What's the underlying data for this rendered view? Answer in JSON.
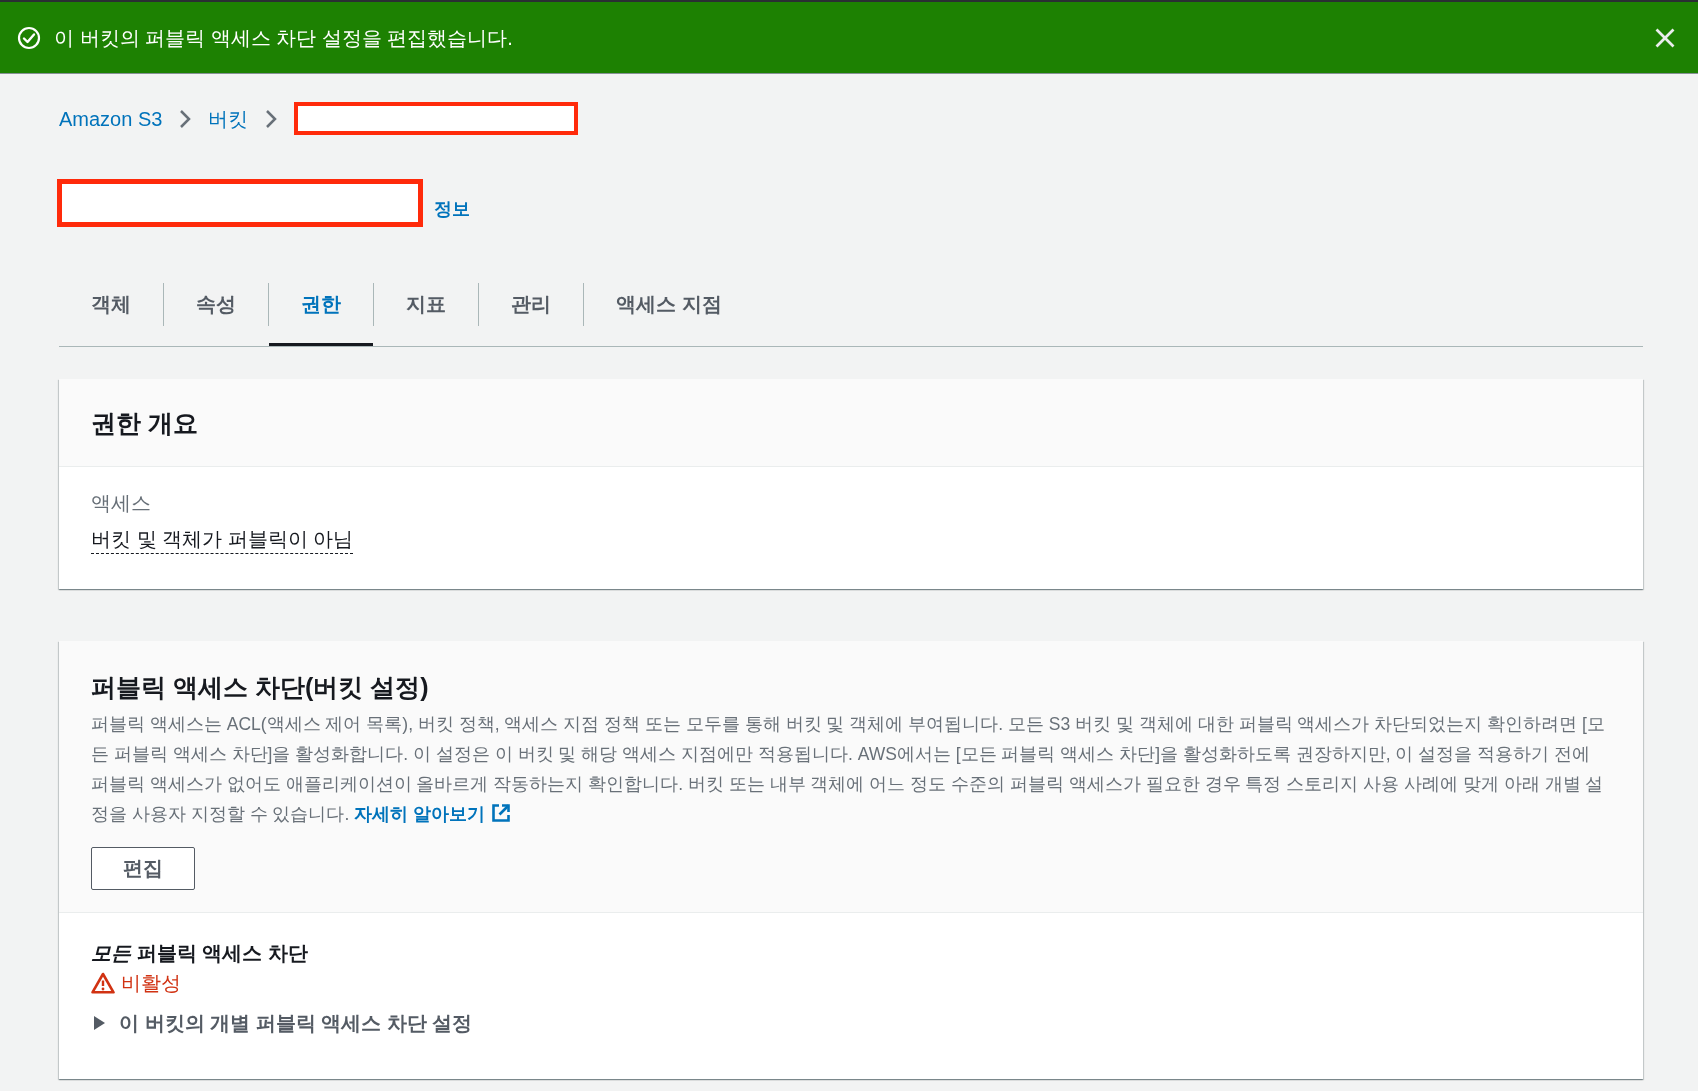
{
  "notification": {
    "kind": "success",
    "message": "이 버킷의 퍼블릭 액세스 차단 설정을 편집했습니다."
  },
  "breadcrumbs": [
    {
      "kind": "link",
      "label": "Amazon S3"
    },
    {
      "kind": "link",
      "label": "버킷"
    },
    {
      "kind": "redacted"
    }
  ],
  "page_header": {
    "title": {
      "kind": "redacted"
    },
    "info_link": "정보"
  },
  "tabs": [
    {
      "label": "객체",
      "selected": false
    },
    {
      "label": "속성",
      "selected": false
    },
    {
      "label": "권한",
      "selected": true
    },
    {
      "label": "지표",
      "selected": false
    },
    {
      "label": "관리",
      "selected": false
    },
    {
      "label": "액세스 지점",
      "selected": false
    }
  ],
  "permissions_overview": {
    "title": "권한 개요",
    "fields": [
      {
        "label": "액세스",
        "value": "버킷 및 객체가 퍼블릭이 아님"
      }
    ]
  },
  "block_public_access": {
    "title": "퍼블릭 액세스 차단(버킷 설정)",
    "description": "퍼블릭 액세스는 ACL(액세스 제어 목록), 버킷 정책, 액세스 지점 정책 또는 모두를 통해 버킷 및 객체에 부여됩니다. 모든 S3 버킷 및 객체에 대한 퍼블릭 액세스가 차단되었는지 확인하려면 [모든 퍼블릭 액세스 차단]을 활성화합니다. 이 설정은 이 버킷 및 해당 액세스 지점에만 적용됩니다. AWS에서는 [모든 퍼블릭 액세스 차단]을 활성화하도록 권장하지만, 이 설정을 적용하기 전에 퍼블릭 액세스가 없어도 애플리케이션이 올바르게 작동하는지 확인합니다. 버킷 또는 내부 객체에 어느 정도 수준의 퍼블릭 액세스가 필요한 경우 특정 스토리지 사용 사례에 맞게 아래 개별 설정을 사용자 지정할 수 있습니다.",
    "learn_more_link": "자세히 알아보기",
    "edit_button": "편집",
    "setting": {
      "label": "*모든* 퍼블릭 액세스 차단",
      "status": {
        "kind": "warning",
        "text": "비활성"
      }
    },
    "details": {
      "label": "이 버킷의 개별 퍼블릭 액세스 차단 설정",
      "expanded": false
    }
  }
}
